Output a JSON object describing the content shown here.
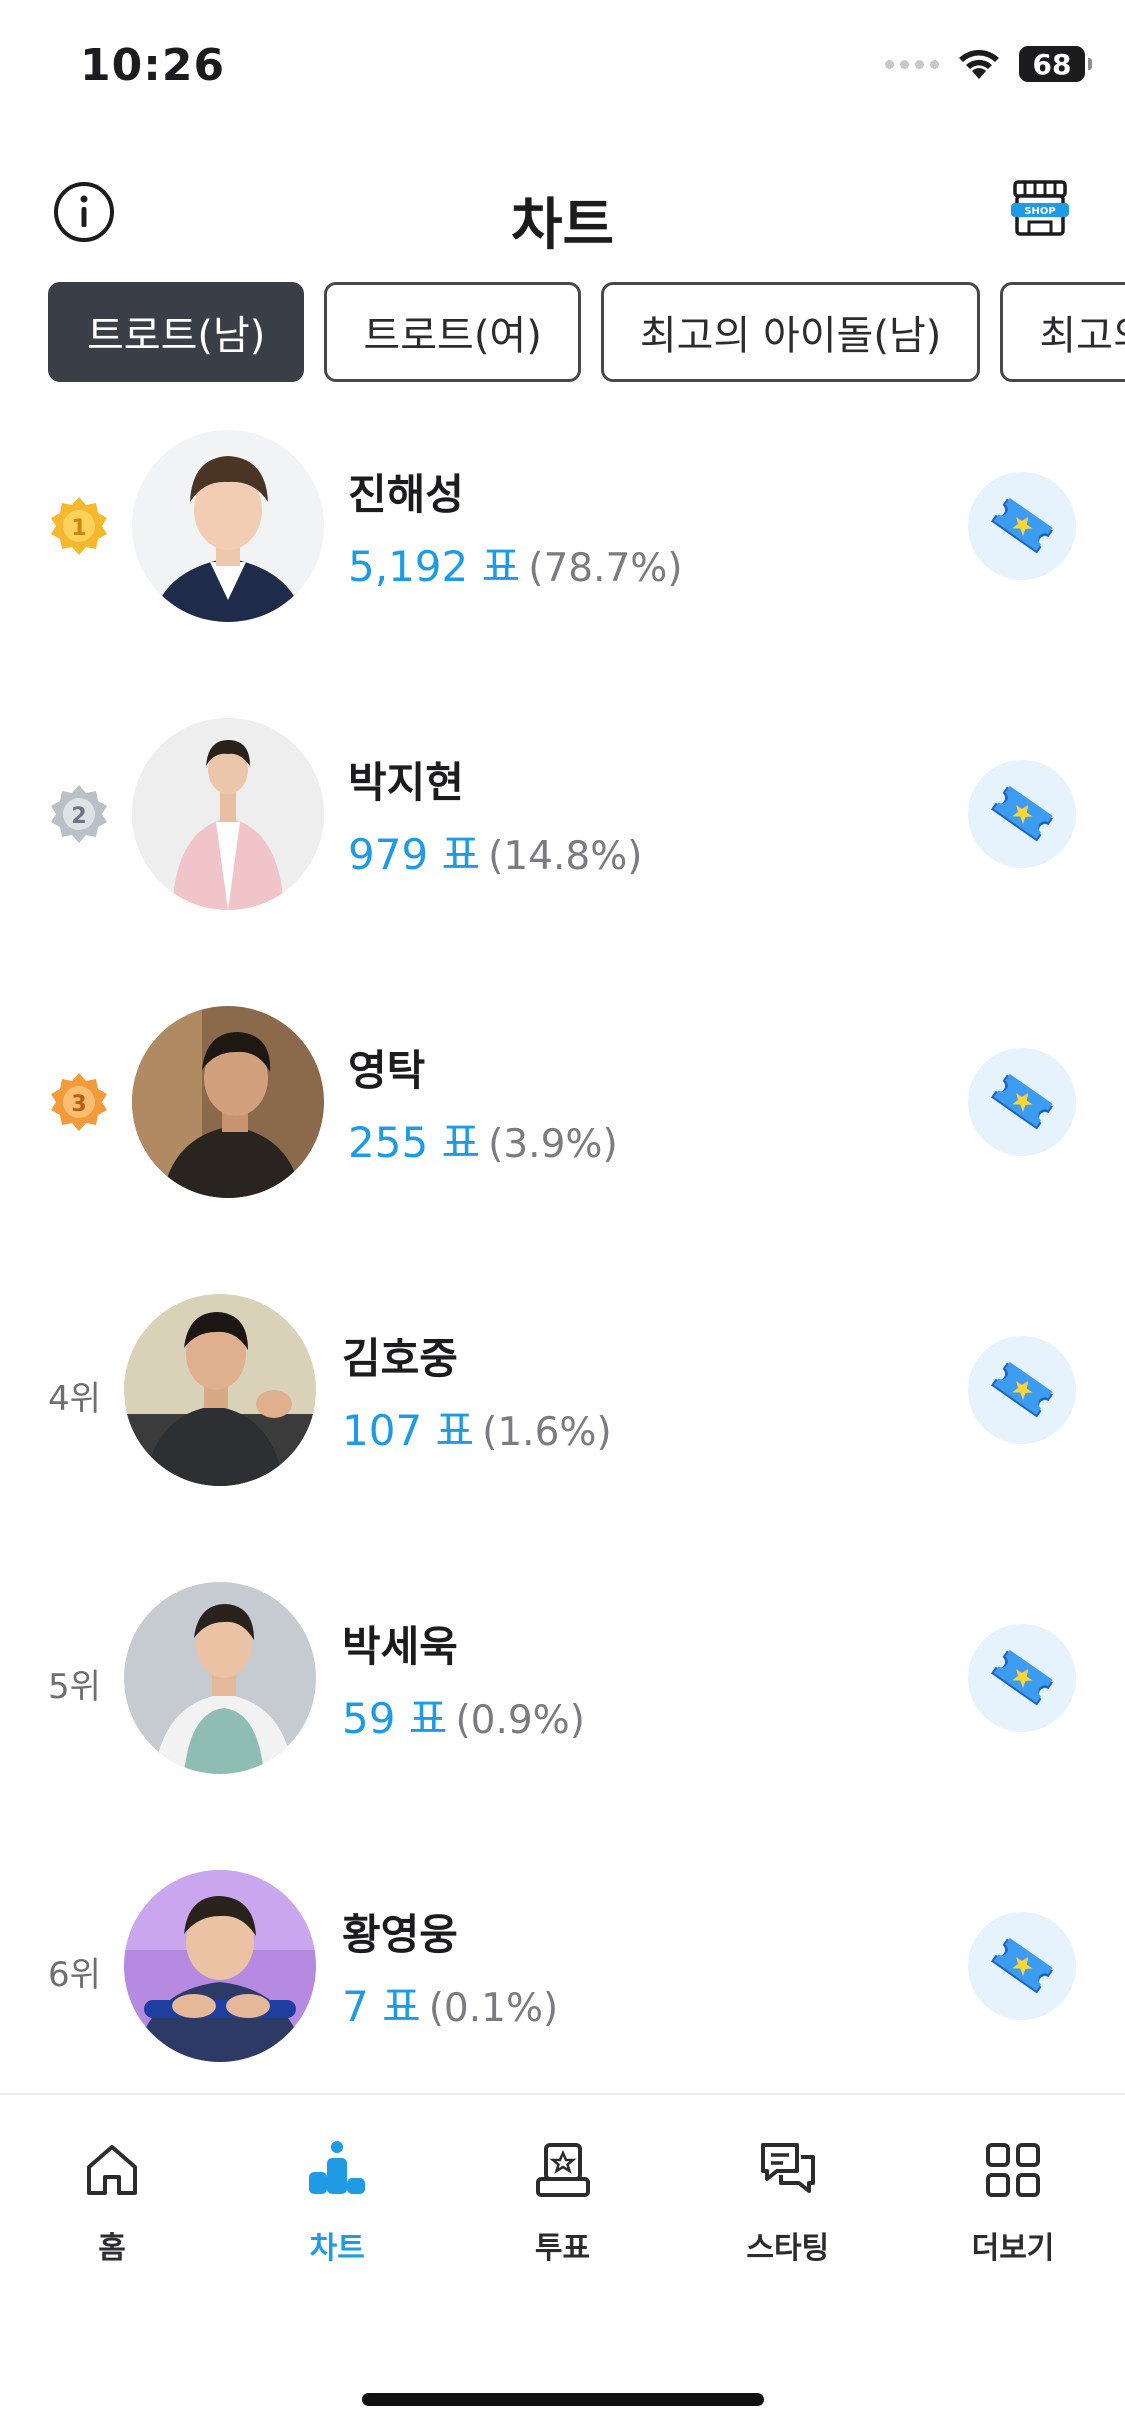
{
  "status_bar": {
    "time": "10:26",
    "battery": "68"
  },
  "header": {
    "title": "차트"
  },
  "tabs": [
    {
      "label": "트로트(남)",
      "active": true
    },
    {
      "label": "트로트(여)",
      "active": false
    },
    {
      "label": "최고의 아이돌(남)",
      "active": false
    },
    {
      "label": "최고의",
      "active": false
    }
  ],
  "rankings": [
    {
      "medal": "1",
      "name": "진해성",
      "votes": "5,192 표",
      "percent": "(78.7%)"
    },
    {
      "medal": "2",
      "name": "박지현",
      "votes": "979 표",
      "percent": "(14.8%)"
    },
    {
      "medal": "3",
      "name": "영탁",
      "votes": "255 표",
      "percent": "(3.9%)"
    },
    {
      "rank_label": "4위",
      "name": "김호중",
      "votes": "107 표",
      "percent": "(1.6%)"
    },
    {
      "rank_label": "5위",
      "name": "박세욱",
      "votes": "59 표",
      "percent": "(0.9%)"
    },
    {
      "rank_label": "6위",
      "name": "황영웅",
      "votes": "7 표",
      "percent": "(0.1%)"
    }
  ],
  "bottom_nav": [
    {
      "label": "홈",
      "icon": "home-icon",
      "active": false
    },
    {
      "label": "차트",
      "icon": "chart-icon",
      "active": true
    },
    {
      "label": "투표",
      "icon": "ballot-icon",
      "active": false
    },
    {
      "label": "스타팅",
      "icon": "chat-icon",
      "active": false
    },
    {
      "label": "더보기",
      "icon": "grid-icon",
      "active": false
    }
  ],
  "colors": {
    "accent": "#1e9be4",
    "active_tab": "#3a3f47",
    "gold": "#f5b82e",
    "silver": "#b8c0c8",
    "bronze": "#f39a3a",
    "vote_button_bg": "#e6f3fd"
  }
}
